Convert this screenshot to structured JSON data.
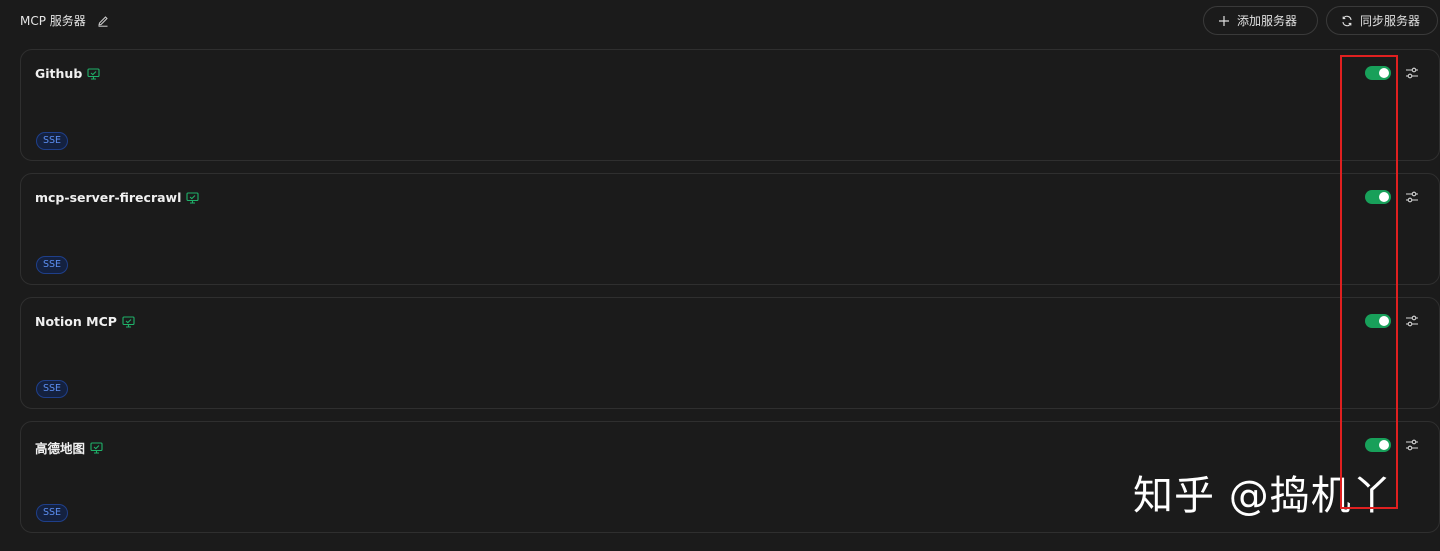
{
  "header": {
    "title": "MCP 服务器",
    "add_label": "添加服务器",
    "sync_label": "同步服务器"
  },
  "servers": [
    {
      "name": "Github",
      "badge": "SSE",
      "enabled": true
    },
    {
      "name": "mcp-server-firecrawl",
      "badge": "SSE",
      "enabled": true
    },
    {
      "name": "Notion MCP",
      "badge": "SSE",
      "enabled": true
    },
    {
      "name": "高德地图",
      "badge": "SSE",
      "enabled": true
    }
  ],
  "watermark": "知乎 @捣机丫",
  "colors": {
    "background": "#1b1b1b",
    "toggle_on": "#18a05a",
    "badge_text": "#5b8def",
    "monitor_icon": "#1fb26a",
    "highlight_box": "#e02020"
  }
}
